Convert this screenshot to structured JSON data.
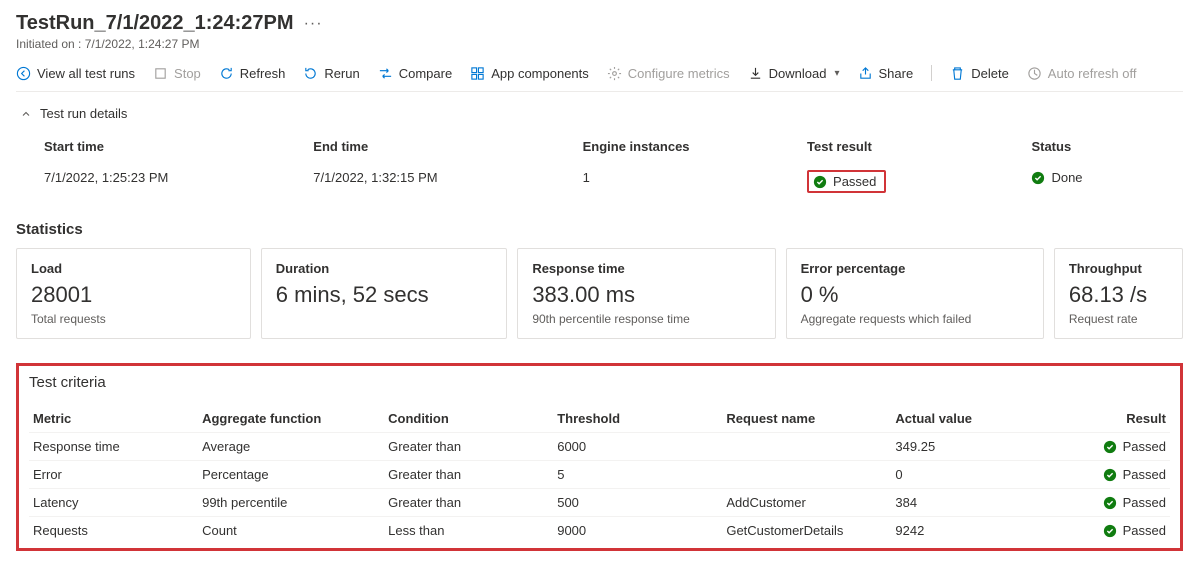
{
  "header": {
    "title": "TestRun_7/1/2022_1:24:27PM",
    "subtitle": "Initiated on : 7/1/2022, 1:24:27 PM"
  },
  "toolbar": {
    "viewAll": "View all test runs",
    "stop": "Stop",
    "refresh": "Refresh",
    "rerun": "Rerun",
    "compare": "Compare",
    "appComponents": "App components",
    "configureMetrics": "Configure metrics",
    "download": "Download",
    "share": "Share",
    "delete": "Delete",
    "autoRefreshOff": "Auto refresh off"
  },
  "details": {
    "sectionLabel": "Test run details",
    "headers": {
      "startTime": "Start time",
      "endTime": "End time",
      "engineInstances": "Engine instances",
      "testResult": "Test result",
      "status": "Status"
    },
    "row": {
      "startTime": "7/1/2022, 1:25:23 PM",
      "endTime": "7/1/2022, 1:32:15 PM",
      "engineInstances": "1",
      "testResult": "Passed",
      "status": "Done"
    }
  },
  "statistics": {
    "title": "Statistics",
    "cards": [
      {
        "label": "Load",
        "value": "28001",
        "desc": "Total requests"
      },
      {
        "label": "Duration",
        "value": "6 mins, 52 secs",
        "desc": ""
      },
      {
        "label": "Response time",
        "value": "383.00 ms",
        "desc": "90th percentile response time"
      },
      {
        "label": "Error percentage",
        "value": "0 %",
        "desc": "Aggregate requests which failed"
      },
      {
        "label": "Throughput",
        "value": "68.13 /s",
        "desc": "Request rate"
      }
    ]
  },
  "criteria": {
    "title": "Test criteria",
    "headers": {
      "metric": "Metric",
      "aggregate": "Aggregate function",
      "condition": "Condition",
      "threshold": "Threshold",
      "requestName": "Request name",
      "actualValue": "Actual value",
      "result": "Result"
    },
    "rows": [
      {
        "metric": "Response time",
        "aggregate": "Average",
        "condition": "Greater than",
        "threshold": "6000",
        "requestName": "",
        "actualValue": "349.25",
        "result": "Passed"
      },
      {
        "metric": "Error",
        "aggregate": "Percentage",
        "condition": "Greater than",
        "threshold": "5",
        "requestName": "",
        "actualValue": "0",
        "result": "Passed"
      },
      {
        "metric": "Latency",
        "aggregate": "99th percentile",
        "condition": "Greater than",
        "threshold": "500",
        "requestName": "AddCustomer",
        "actualValue": "384",
        "result": "Passed"
      },
      {
        "metric": "Requests",
        "aggregate": "Count",
        "condition": "Less than",
        "threshold": "9000",
        "requestName": "GetCustomerDetails",
        "actualValue": "9242",
        "result": "Passed"
      }
    ]
  }
}
